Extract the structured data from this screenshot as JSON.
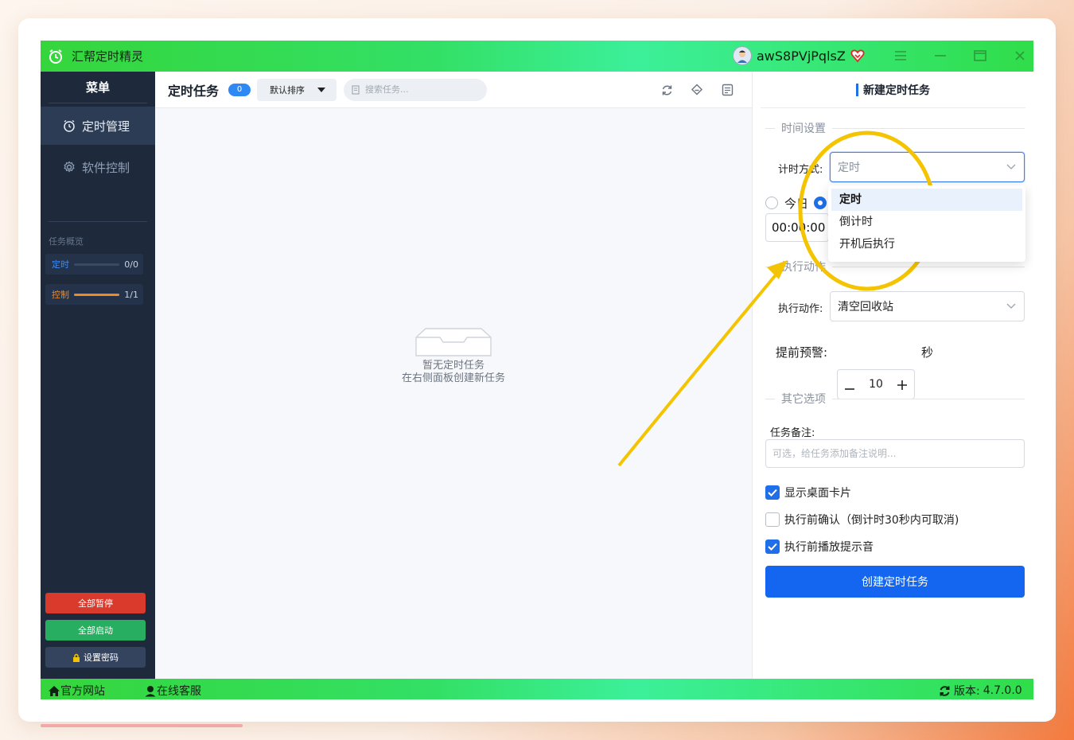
{
  "app": {
    "title": "汇帮定时精灵",
    "username": "awS8PVjPqlsZ",
    "version_label": "版本:",
    "version": "4.7.0.0"
  },
  "sidebar": {
    "menu_title": "菜单",
    "items": [
      {
        "label": "定时管理",
        "icon": "alarm-clock-icon",
        "active": true
      },
      {
        "label": "软件控制",
        "icon": "gear-icon",
        "active": false
      }
    ],
    "overview_title": "任务概览",
    "overview": [
      {
        "label": "定时",
        "count": "0/0",
        "progress": 0,
        "color": "#3b8df5"
      },
      {
        "label": "控制",
        "count": "1/1",
        "progress": 1,
        "color": "#f08a24"
      }
    ],
    "buttons": {
      "pause_all": "全部暂停",
      "start_all": "全部启动",
      "set_password": "设置密码"
    }
  },
  "main": {
    "title": "定时任务",
    "count": "0",
    "sort_label": "默认排序",
    "search_placeholder": "搜索任务...",
    "empty_line1": "暂无定时任务",
    "empty_line2": "在右侧面板创建新任务"
  },
  "panel": {
    "title": "新建定时任务",
    "time_section": "时间设置",
    "timing_mode_label": "计时方式:",
    "timing_mode_value": "定时",
    "timing_mode_options": [
      "定时",
      "倒计时",
      "开机后执行"
    ],
    "today_label": "今日",
    "time_value": "00:00:00",
    "action_section": "执行动作",
    "action_label": "执行动作:",
    "action_value": "清空回收站",
    "warn_label": "提前预警:",
    "warn_value": "10",
    "warn_unit": "秒",
    "other_section": "其它选项",
    "note_label": "任务备注:",
    "note_placeholder": "可选，给任务添加备注说明...",
    "options": [
      {
        "label": "显示桌面卡片",
        "checked": true
      },
      {
        "label": "执行前确认（倒计时30秒内可取消)",
        "checked": false
      },
      {
        "label": "执行前播放提示音",
        "checked": true
      }
    ],
    "create_button": "创建定时任务"
  },
  "statusbar": {
    "website": "官方网站",
    "support": "在线客服"
  },
  "colors": {
    "titlebar_green": "#35d63c",
    "primary_blue": "#1465ef",
    "sidebar_bg": "#1e2a3c",
    "danger_red": "#d93a2b",
    "success_green": "#27ae60",
    "annotation_yellow": "#f5c400"
  }
}
